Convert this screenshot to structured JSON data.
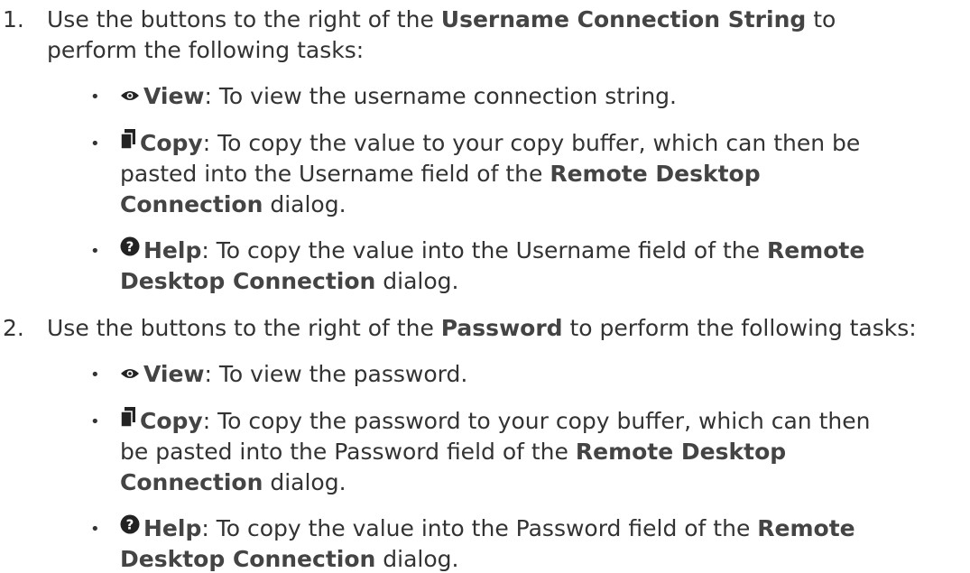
{
  "items": [
    {
      "number": "1.",
      "text_a": "Use the buttons to the right of the ",
      "bold": "Username Connection String",
      "text_b": " to",
      "text_c": "perform the following tasks:",
      "bullets": [
        {
          "icon": "eye-icon",
          "label": "View",
          "line1": ": To view the username connection string."
        },
        {
          "icon": "copy-icon",
          "label": "Copy",
          "line1": ": To copy the value to your copy buffer, which can then be",
          "line2a": "pasted into the Username field of the ",
          "line2b": "Remote Desktop",
          "line3a": "Connection",
          "line3b": " dialog."
        },
        {
          "icon": "help-icon",
          "label": "Help",
          "line1a": ": To copy the value into the Username field of the ",
          "line1b": "Remote",
          "line2a": "Desktop Connection",
          "line2b": " dialog."
        }
      ]
    },
    {
      "number": "2.",
      "text_a": "Use the buttons to the right of the ",
      "bold": "Password",
      "text_b": " to perform the following tasks:",
      "bullets": [
        {
          "icon": "eye-icon",
          "label": "View",
          "line1": ": To view the password."
        },
        {
          "icon": "copy-icon",
          "label": "Copy",
          "line1": ": To copy the password to your copy buffer, which can then",
          "line2a": "be pasted into the Password field of the ",
          "line2b": "Remote Desktop",
          "line3a": "Connection",
          "line3b": " dialog."
        },
        {
          "icon": "help-icon",
          "label": "Help",
          "line1a": ": To copy the value into the Password field of the ",
          "line1b": "Remote",
          "line2a": "Desktop Connection",
          "line2b": " dialog."
        }
      ]
    }
  ]
}
